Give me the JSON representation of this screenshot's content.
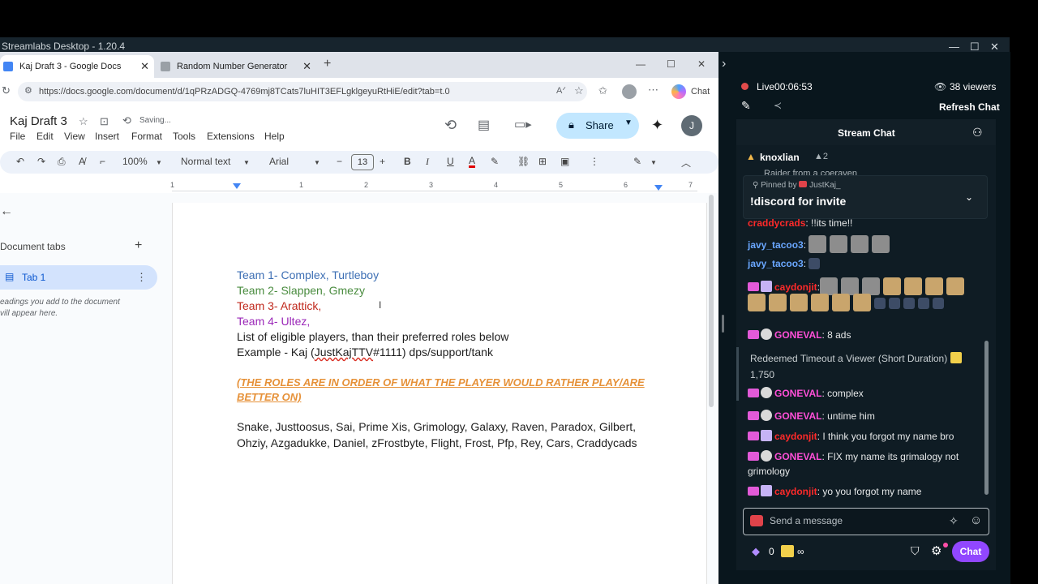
{
  "streamlabs": {
    "title": "Streamlabs Desktop - 1.20.4",
    "minimize": "—",
    "maximize": "☐",
    "close": "✕",
    "collapse_arrow": "›"
  },
  "browser": {
    "tabs": [
      {
        "label": "Kaj Draft 3 - Google Docs",
        "active": true
      },
      {
        "label": "Random Number Generator",
        "active": false
      }
    ],
    "new_tab": "+",
    "url": "https://docs.google.com/document/d/1qPRzADGQ-4769mj8TCats7luHIT3EFLgklgeyuRtHiE/edit?tab=t.0",
    "chat_label": "Chat",
    "window_min": "—",
    "window_max": "☐",
    "window_close": "✕"
  },
  "docs": {
    "title": "Kaj Draft 3",
    "saving": "Saving...",
    "menu": [
      "File",
      "Edit",
      "View",
      "Insert",
      "Format",
      "Tools",
      "Extensions",
      "Help"
    ],
    "share_label": "Share",
    "avatar_letter": "J",
    "toolbar": {
      "zoom": "100%",
      "style": "Normal text",
      "font": "Arial",
      "font_size": "13"
    },
    "ruler_numbers": [
      "1",
      "1",
      "2",
      "3",
      "4",
      "5",
      "6",
      "7"
    ],
    "left_pane": {
      "doc_tabs_label": "Document tabs",
      "tab1_label": "Tab 1",
      "hint_line1": "eadings you add to the document",
      "hint_line2": "vill appear here."
    },
    "content": {
      "team1": "Team 1- Complex, Turtleboy",
      "team2": "Team 2- Slappen, Gmezy",
      "team3": "Team 3- Arattick,",
      "team4": "Team 4- Ultez,",
      "list_intro": "List of eligible players, than their preferred roles below",
      "example_prefix": "Example - Kaj (",
      "example_tag": "JustKajTTV",
      "example_suffix": "#1111)  dps/support/tank",
      "note_line1": "(THE ROLES ARE IN ORDER OF WHAT THE PLAYER WOULD RATHER PLAY/ARE",
      "note_line2": "BETTER ON)",
      "players_line1": "Snake, Justtoosus, Sai, Prime Xis, Grimology, Galaxy, Raven, Paradox, Gilbert,",
      "players_line2": "Ohziy, Azgadukke, Daniel, zFrostbyte, Flight, Frost, Pfp, Rey, Cars, Craddycads"
    },
    "colors": {
      "team1": "#3d6fb4",
      "team2": "#4a8c3f",
      "team3": "#c0281c",
      "team4": "#9b28b8",
      "note": "#e69138"
    }
  },
  "stream": {
    "live_label": "Live",
    "live_time": "00:06:53",
    "viewers": "38 viewers",
    "refresh_chat": "Refresh Chat",
    "chat_title": "Stream Chat",
    "top_user": "knoxlian",
    "top_user_count": "2",
    "raider_partial": "Raider from a coeraven",
    "pinned_by_prefix": "Pinned by",
    "pinned_by_user": "JustKaj_",
    "pinned_message": "!discord for invite",
    "messages": [
      {
        "user": "craddycrads",
        "text": ": !!its time!!",
        "color": "red"
      },
      {
        "user": "javy_tacoo3",
        "text": ":",
        "color": "blue"
      },
      {
        "user": "javy_tacoo3",
        "text": ":",
        "color": "blue"
      },
      {
        "user": "caydonjit",
        "text": ":",
        "color": "red"
      },
      {
        "user": "GONEVAL",
        "text": ": 8 ads",
        "color": "pink"
      },
      {
        "user": "GONEVAL",
        "text": ": complex",
        "color": "pink"
      },
      {
        "user": "GONEVAL",
        "text": ": untime him",
        "color": "pink"
      },
      {
        "user": "caydonjit",
        "text": ": I think you forgot my name bro",
        "color": "red"
      },
      {
        "user": "GONEVAL",
        "text": ": FIX my name its grimalogy not",
        "color": "pink"
      },
      {
        "user": "",
        "text": "grimology",
        "color": "none"
      },
      {
        "user": "caydonjit",
        "text": ": yo you forgot my name",
        "color": "red"
      }
    ],
    "redeem_text": "Redeemed Timeout a Viewer (Short Duration)",
    "redeem_cost": "1,750",
    "input_placeholder": "Send a message",
    "bits_count": "0",
    "points_symbol": "∞",
    "chat_button": "Chat"
  }
}
